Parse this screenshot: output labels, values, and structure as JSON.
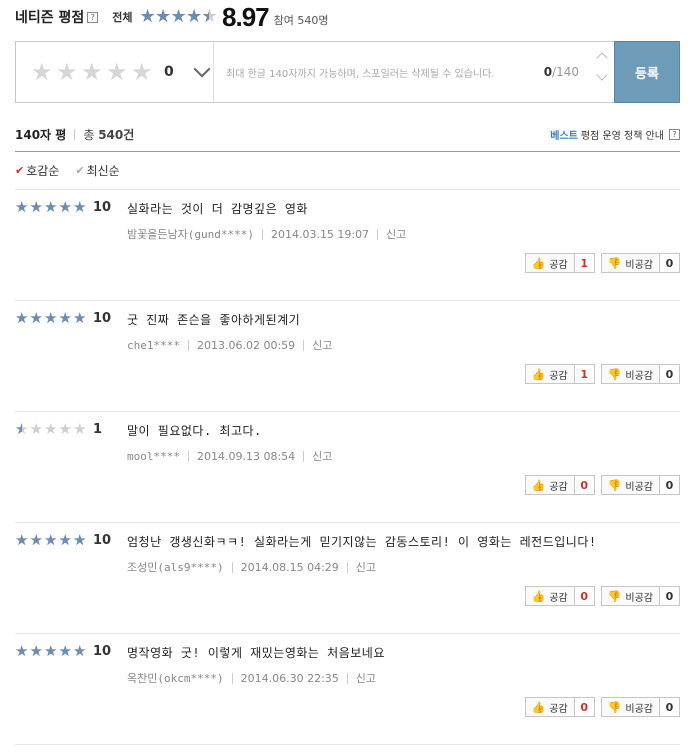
{
  "header": {
    "title": "네티즌 평점",
    "help": "?",
    "all_label": "전체",
    "rating_fraction": 0.897,
    "score": "8.97",
    "participants": "참여 540명"
  },
  "write": {
    "rating_value": "0",
    "placeholder": "최대 한글 140자까지 가능하며, 스포일러는 삭제될 수 있습니다.",
    "count_current": "0",
    "count_max": "/140",
    "submit_label": "등록"
  },
  "summary": {
    "label": "140자 평",
    "total_prefix": "총",
    "total_count": "540",
    "total_suffix": "건",
    "policy_best": "베스트",
    "policy_rest": "평점 운영 정책 안내",
    "help": "?"
  },
  "sort": {
    "options": [
      {
        "label": "호감순",
        "active": true
      },
      {
        "label": "최신순",
        "active": false
      }
    ]
  },
  "actions": {
    "like_label": "공감",
    "dislike_label": "비공감",
    "report_label": "신고"
  },
  "reviews": [
    {
      "score": "10",
      "text": "실화라는 것이 더 감명깊은 영화",
      "author": "밤꽃을든남자(gund****)",
      "date": "2014.03.15 19:07",
      "likes": "1",
      "dislikes": "0"
    },
    {
      "score": "10",
      "text": "굿 진짜 존슨을 좋아하게된계기",
      "author": "che1****",
      "date": "2013.06.02 00:59",
      "likes": "1",
      "dislikes": "0"
    },
    {
      "score": "1",
      "text": "말이 필요없다. 최고다.",
      "author": "mool****",
      "date": "2014.09.13 08:54",
      "likes": "0",
      "dislikes": "0"
    },
    {
      "score": "10",
      "text": "엄청난 갱생신화ㅋㅋ! 실화라는게 믿기지않는 감동스토리! 이 영화는 레전드입니다!",
      "author": "조성민(als9****)",
      "date": "2014.08.15 04:29",
      "likes": "0",
      "dislikes": "0"
    },
    {
      "score": "10",
      "text": "명작영화 굿! 이렇게 재밌는영화는 처음보네요",
      "author": "옥찬민(okcm****)",
      "date": "2014.06.30 22:35",
      "likes": "0",
      "dislikes": "0"
    }
  ]
}
